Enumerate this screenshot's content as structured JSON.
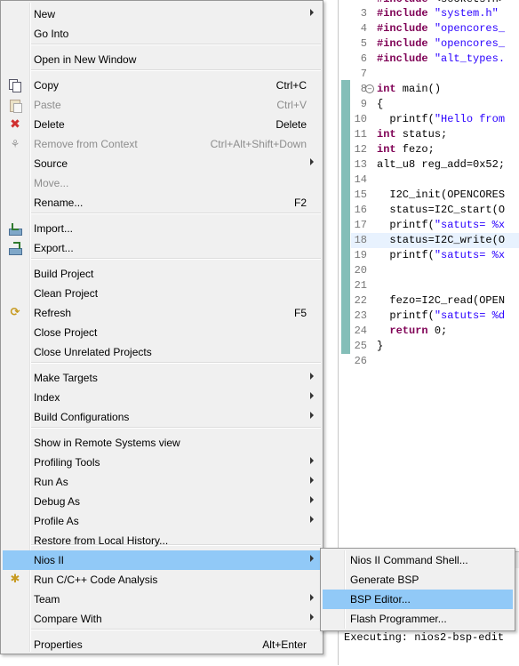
{
  "editor": {
    "lines": [
      {
        "num": "",
        "code": "#include <sockets.h>"
      },
      {
        "num": "3",
        "code": "#include \"system.h\""
      },
      {
        "num": "4",
        "code": "#include \"opencores_"
      },
      {
        "num": "5",
        "code": "#include \"opencores_"
      },
      {
        "num": "6",
        "code": "#include \"alt_types."
      },
      {
        "num": "7",
        "code": ""
      },
      {
        "num": "8",
        "code": "int main()"
      },
      {
        "num": "9",
        "code": "{"
      },
      {
        "num": "10",
        "code": "  printf(\"Hello from"
      },
      {
        "num": "11",
        "code": "int status;"
      },
      {
        "num": "12",
        "code": "int fezo;"
      },
      {
        "num": "13",
        "code": "alt_u8 reg_add=0x52;"
      },
      {
        "num": "14",
        "code": ""
      },
      {
        "num": "15",
        "code": "  I2C_init(OPENCORES"
      },
      {
        "num": "16",
        "code": "  status=I2C_start(O"
      },
      {
        "num": "17",
        "code": "  printf(\"satuts= %x"
      },
      {
        "num": "18",
        "code": "  status=I2C_write(O"
      },
      {
        "num": "19",
        "code": "  printf(\"satuts= %x"
      },
      {
        "num": "20",
        "code": ""
      },
      {
        "num": "21",
        "code": ""
      },
      {
        "num": "22",
        "code": "  fezo=I2C_read(OPEN"
      },
      {
        "num": "23",
        "code": "  printf(\"satuts= %d"
      },
      {
        "num": "24",
        "code": "  return 0;"
      },
      {
        "num": "25",
        "code": "}"
      },
      {
        "num": "26",
        "code": ""
      }
    ],
    "fold_marker": "−"
  },
  "console": {
    "text": "Executing: nios2-bsp-edit"
  },
  "menu": {
    "items": [
      {
        "label": "New",
        "submenu": true,
        "icon": "none"
      },
      {
        "label": "Go Into",
        "icon": "none"
      },
      {
        "label": "Open in New Window",
        "icon": "none"
      },
      {
        "label": "Copy",
        "accel": "Ctrl+C",
        "icon": "copy-icon"
      },
      {
        "label": "Paste",
        "accel": "Ctrl+V",
        "disabled": true,
        "icon": "paste-icon"
      },
      {
        "label": "Delete",
        "accel": "Delete",
        "icon": "delete-icon",
        "glyph": "✖"
      },
      {
        "label": "Remove from Context",
        "accel": "Ctrl+Alt+Shift+Down",
        "disabled": true,
        "icon": "remove-from-context-icon",
        "glyph": "⚘"
      },
      {
        "label": "Source",
        "submenu": true,
        "icon": "none"
      },
      {
        "label": "Move...",
        "disabled": true,
        "icon": "none"
      },
      {
        "label": "Rename...",
        "accel": "F2",
        "icon": "none"
      },
      {
        "label": "Import...",
        "icon": "import-icon"
      },
      {
        "label": "Export...",
        "icon": "export-icon"
      },
      {
        "label": "Build Project",
        "icon": "none"
      },
      {
        "label": "Clean Project",
        "icon": "none"
      },
      {
        "label": "Refresh",
        "accel": "F5",
        "icon": "refresh-icon",
        "glyph": "⟳"
      },
      {
        "label": "Close Project",
        "icon": "none"
      },
      {
        "label": "Close Unrelated Projects",
        "icon": "none"
      },
      {
        "label": "Make Targets",
        "submenu": true,
        "icon": "none"
      },
      {
        "label": "Index",
        "submenu": true,
        "icon": "none"
      },
      {
        "label": "Build Configurations",
        "submenu": true,
        "icon": "none"
      },
      {
        "label": "Show in Remote Systems view",
        "icon": "none"
      },
      {
        "label": "Profiling Tools",
        "submenu": true,
        "icon": "none"
      },
      {
        "label": "Run As",
        "submenu": true,
        "icon": "none"
      },
      {
        "label": "Debug As",
        "submenu": true,
        "icon": "none"
      },
      {
        "label": "Profile As",
        "submenu": true,
        "icon": "none"
      },
      {
        "label": "Restore from Local History...",
        "icon": "none"
      },
      {
        "label": "Nios II",
        "submenu": true,
        "selected": true,
        "icon": "none"
      },
      {
        "label": "Run C/C++ Code Analysis",
        "icon": "code-analysis-icon",
        "glyph": "✱"
      },
      {
        "label": "Team",
        "submenu": true,
        "icon": "none"
      },
      {
        "label": "Compare With",
        "submenu": true,
        "icon": "none"
      },
      {
        "label": "Properties",
        "accel": "Alt+Enter",
        "icon": "none"
      }
    ]
  },
  "submenu": {
    "items": [
      {
        "label": "Nios II Command Shell..."
      },
      {
        "label": "Generate BSP"
      },
      {
        "label": "BSP Editor...",
        "selected": true
      },
      {
        "label": "Flash Programmer..."
      }
    ]
  },
  "colors": {
    "menu_bg": "#f0f0f0",
    "selection": "#91c9f7",
    "disabled_text": "#8d8d8d",
    "keyword": "#7f0055",
    "string": "#2a00ff"
  }
}
